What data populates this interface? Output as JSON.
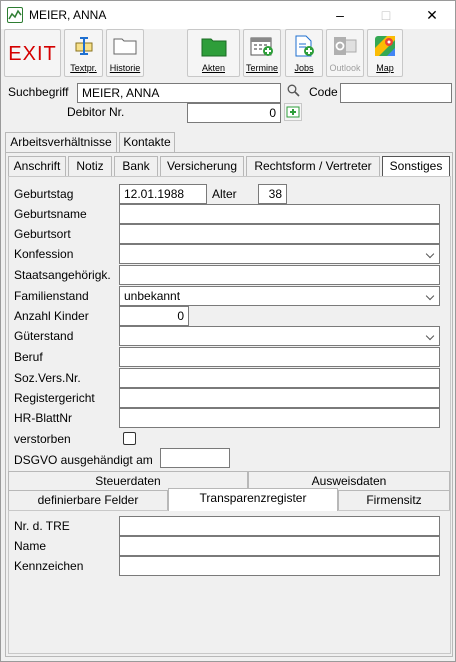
{
  "window": {
    "title": "MEIER, ANNA",
    "minimize": "–",
    "maximize": "□",
    "close": "✕"
  },
  "toolbar": {
    "exit": "EXIT",
    "textpr": "Textpr.",
    "historie": "Historie",
    "akten": "Akten",
    "termine": "Termine",
    "jobs": "Jobs",
    "outlook": "Outlook",
    "map": "Map"
  },
  "header": {
    "suchbegriff_label": "Suchbegriff",
    "suchbegriff_value": "MEIER, ANNA",
    "code_label": "Code",
    "code_value": "",
    "debitor_label": "Debitor Nr.",
    "debitor_value": "0"
  },
  "tabs_top": [
    "Arbeitsverhältnisse",
    "Kontakte"
  ],
  "tabs_main": [
    "Anschrift",
    "Notiz",
    "Bank",
    "Versicherung",
    "Rechtsform / Vertreter",
    "Sonstiges"
  ],
  "form": {
    "geburtstag_label": "Geburtstag",
    "geburtstag_value": "12.01.1988",
    "alter_label": "Alter",
    "alter_value": "38",
    "geburtsname_label": "Geburtsname",
    "geburtsort_label": "Geburtsort",
    "konfession_label": "Konfession",
    "staatsangehoerigkeit_label": "Staatsangehörigk.",
    "familienstand_label": "Familienstand",
    "familienstand_value": "unbekannt",
    "anzahl_kinder_label": "Anzahl Kinder",
    "anzahl_kinder_value": "0",
    "gueterstand_label": "Güterstand",
    "beruf_label": "Beruf",
    "sozvers_label": "Soz.Vers.Nr.",
    "registergericht_label": "Registergericht",
    "hrblatt_label": "HR-BlattNr",
    "verstorben_label": "verstorben",
    "dsgvo_label": "DSGVO ausgehändigt am"
  },
  "tabs_sub_row1": [
    "Steuerdaten",
    "Ausweisdaten"
  ],
  "tabs_sub_row2": [
    "definierbare Felder",
    "Transparenzregister",
    "Firmensitz"
  ],
  "tre": {
    "nr_label": "Nr. d. TRE",
    "name_label": "Name",
    "kennzeichen_label": "Kennzeichen"
  }
}
